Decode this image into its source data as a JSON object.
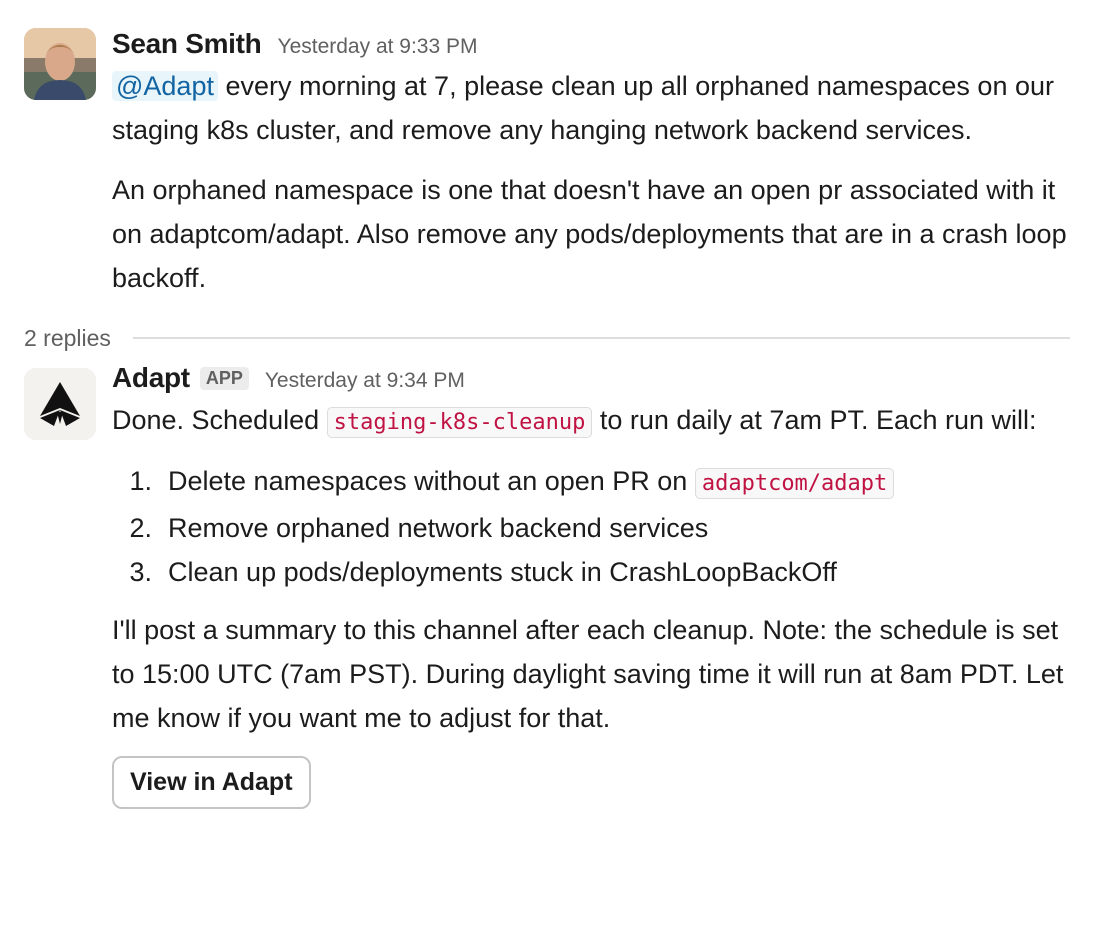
{
  "messages": [
    {
      "author": "Sean Smith",
      "timestamp": "Yesterday at 9:33 PM",
      "mention": "@Adapt",
      "text_line1_rest": " every morning at 7, please clean up all orphaned namespaces on our staging k8s cluster, and remove any hanging network backend services.",
      "paragraph2": "An orphaned namespace is one that doesn't have an open pr associated with it on adaptcom/adapt. Also remove any pods/deployments that are in a crash loop backoff."
    }
  ],
  "thread": {
    "replies_label": "2 replies"
  },
  "reply": {
    "author": "Adapt",
    "badge": "APP",
    "timestamp": "Yesterday at 9:34 PM",
    "intro_before": "Done. Scheduled ",
    "job_name": "staging-k8s-cleanup",
    "intro_after": " to run daily at 7am PT. Each run will:",
    "steps": [
      {
        "num": "1.",
        "before": "Delete namespaces without an open PR on ",
        "code": "adaptcom/adapt"
      },
      {
        "num": "2.",
        "text": "Remove orphaned network backend services"
      },
      {
        "num": "3.",
        "text": "Clean up pods/deployments stuck in CrashLoopBackOff"
      }
    ],
    "summary": "I'll post a summary to this channel after each cleanup. Note: the schedule is set to 15:00 UTC (7am PST). During daylight saving time it will run at 8am PDT. Let me know if you want me to adjust for that.",
    "button_label": "View in Adapt"
  }
}
